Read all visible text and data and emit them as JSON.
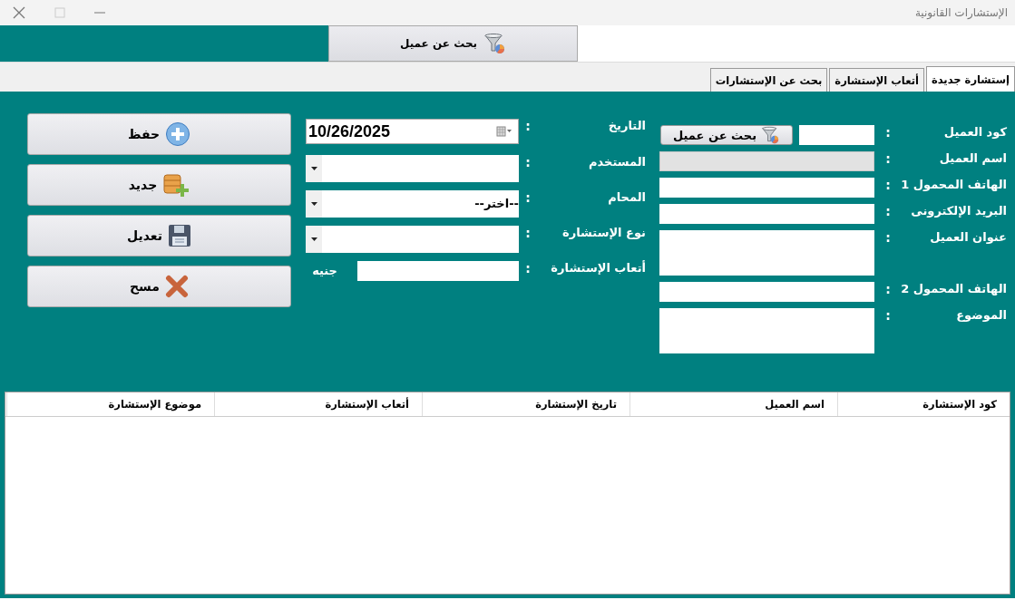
{
  "window": {
    "title": "الإستشارات القانونية"
  },
  "toolbar": {
    "search_button": "بحث عن عميل"
  },
  "tabs": [
    {
      "label": "إستشارة جديدة",
      "selected": true
    },
    {
      "label": "أتعاب الإستشارة",
      "selected": false
    },
    {
      "label": "بحث عن الإستشارات",
      "selected": false
    }
  ],
  "client_form": [
    {
      "label": "كود العميل",
      "colon": ":",
      "kind": "code",
      "button": "بحث عن عميل",
      "disabled": false
    },
    {
      "label": "اسم العميل",
      "colon": ":",
      "kind": "text",
      "disabled": true
    },
    {
      "label": "الهاتف المحمول 1",
      "colon": ":",
      "kind": "text",
      "disabled": false
    },
    {
      "label": "البريد الإلكترونى",
      "colon": ":",
      "kind": "text",
      "disabled": false
    },
    {
      "label": "عنوان العميل",
      "colon": ":",
      "kind": "textarea",
      "disabled": false
    },
    {
      "label": "الهاتف المحمول 2",
      "colon": ":",
      "kind": "text",
      "disabled": false
    },
    {
      "label": "الموضوع",
      "colon": ":",
      "kind": "textarea",
      "disabled": false
    }
  ],
  "consultation_form": [
    {
      "label": "التاريخ",
      "colon": ":",
      "kind": "date",
      "value": "10/26/2025"
    },
    {
      "label": "المستخدم",
      "colon": ":",
      "kind": "combo"
    },
    {
      "label": "المحام",
      "colon": ":",
      "kind": "combo",
      "value": "--اختر--"
    },
    {
      "label": "نوع الإستشارة",
      "colon": ":",
      "kind": "combo"
    },
    {
      "label": "أتعاب الإستشارة",
      "colon": ":",
      "kind": "amount",
      "unit": "جنيه"
    }
  ],
  "actions": [
    {
      "label": "حفظ",
      "kind": "add"
    },
    {
      "label": "جديد",
      "kind": "database"
    },
    {
      "label": "تعديل",
      "kind": "save"
    },
    {
      "label": "مسح",
      "kind": "delete"
    }
  ],
  "table": {
    "columns": [
      "كود الإستشارة",
      "اسم العميل",
      "تاريخ الإستشارة",
      "أتعاب الإستشارة",
      "موضوع الإستشارة"
    ]
  }
}
